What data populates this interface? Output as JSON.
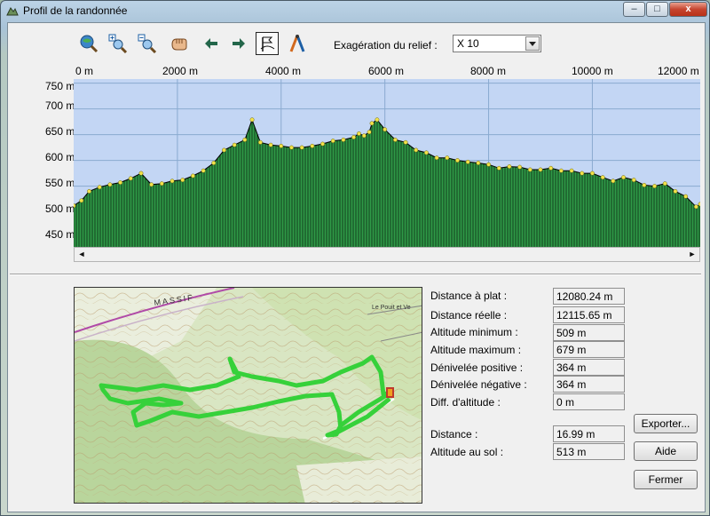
{
  "window": {
    "title": "Profil de la randonnée",
    "controls": {
      "minimize": "–",
      "maximize": "□",
      "close": "x"
    }
  },
  "toolbar": {
    "icons": [
      "zoom-globe-icon",
      "zoom-in-icon",
      "zoom-out-icon",
      "pan-hand-icon",
      "arrow-left-icon",
      "arrow-right-icon",
      "flag-route-icon",
      "measure-compass-icon"
    ],
    "exaggeration_label": "Exagération du relief :",
    "exaggeration_value": "X 10"
  },
  "chart_data": {
    "type": "area",
    "xlabel": "",
    "ylabel": "",
    "x_ticks": [
      "0 m",
      "2000 m",
      "4000 m",
      "6000 m",
      "8000 m",
      "10000 m",
      "12000 m"
    ],
    "y_ticks": [
      "750 m",
      "700 m",
      "650 m",
      "600 m",
      "550 m",
      "500 m",
      "450 m"
    ],
    "xlim": [
      0,
      12080
    ],
    "ylim": [
      432,
      758
    ],
    "colors": {
      "fill": "#2f9a47",
      "stroke": "#000000",
      "point": "#f2e24a",
      "background": "#c3d6f4",
      "grid": "#8aaad0"
    },
    "x": [
      0,
      150,
      300,
      500,
      700,
      900,
      1100,
      1300,
      1500,
      1700,
      1900,
      2100,
      2300,
      2500,
      2700,
      2900,
      3100,
      3300,
      3440,
      3600,
      3800,
      4000,
      4200,
      4400,
      4600,
      4800,
      5000,
      5200,
      5400,
      5500,
      5600,
      5700,
      5750,
      5850,
      6000,
      6200,
      6400,
      6600,
      6800,
      7000,
      7200,
      7400,
      7600,
      7800,
      8000,
      8200,
      8400,
      8600,
      8800,
      9000,
      9200,
      9400,
      9600,
      9800,
      10000,
      10200,
      10400,
      10600,
      10800,
      11000,
      11200,
      11400,
      11600,
      11800,
      12000,
      12080
    ],
    "values": [
      512,
      522,
      540,
      548,
      553,
      557,
      565,
      575,
      553,
      555,
      560,
      562,
      570,
      580,
      595,
      620,
      630,
      640,
      679,
      635,
      630,
      628,
      625,
      625,
      628,
      632,
      638,
      640,
      645,
      652,
      648,
      655,
      672,
      679,
      660,
      640,
      635,
      620,
      615,
      605,
      605,
      600,
      597,
      595,
      592,
      585,
      588,
      587,
      582,
      582,
      585,
      580,
      580,
      575,
      575,
      567,
      560,
      567,
      562,
      552,
      550,
      555,
      540,
      530,
      510,
      515
    ]
  },
  "stats": [
    {
      "label": "Distance à plat :",
      "value": "12080.24 m"
    },
    {
      "label": "Distance réelle :",
      "value": "12115.65 m"
    },
    {
      "label": "Altitude minimum :",
      "value": "509 m"
    },
    {
      "label": "Altitude maximum :",
      "value": "679 m"
    },
    {
      "label": "Dénivelée positive :",
      "value": "364 m"
    },
    {
      "label": "Dénivelée négative :",
      "value": "364 m"
    },
    {
      "label": "Diff. d'altitude :",
      "value": "0 m"
    }
  ],
  "cursor": [
    {
      "label": "Distance :",
      "value": "16.99 m"
    },
    {
      "label": "Altitude au sol :",
      "value": "513 m"
    }
  ],
  "buttons": {
    "export": "Exporter...",
    "help": "Aide",
    "close": "Fermer"
  },
  "map": {
    "labels": [
      "MASSIF",
      "Le Pouit et Ve"
    ]
  }
}
